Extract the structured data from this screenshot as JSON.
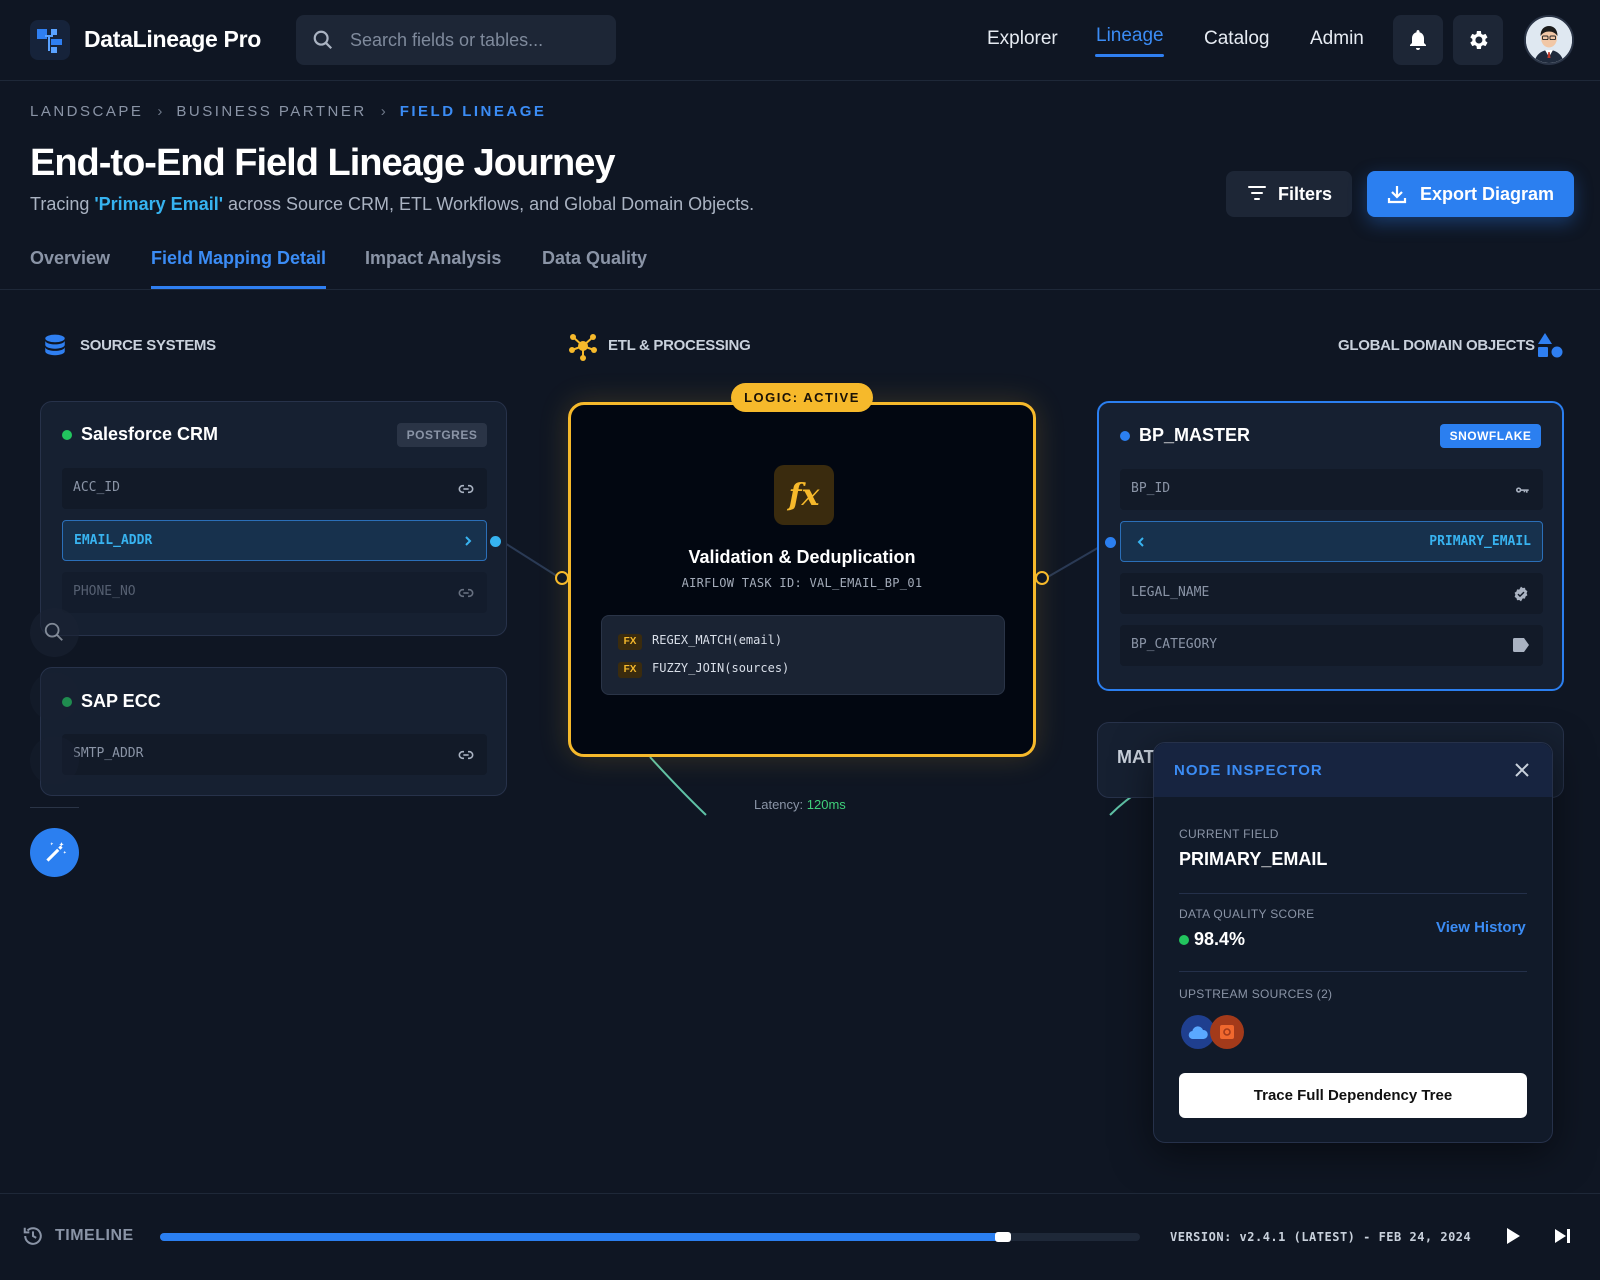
{
  "app": {
    "name": "DataLineage Pro"
  },
  "search": {
    "placeholder": "Search fields or tables..."
  },
  "nav": {
    "items": [
      {
        "label": "Explorer"
      },
      {
        "label": "Lineage"
      },
      {
        "label": "Catalog"
      },
      {
        "label": "Admin"
      }
    ],
    "active": "Lineage"
  },
  "breadcrumb": [
    "LANDSCAPE",
    "BUSINESS PARTNER",
    "FIELD LINEAGE"
  ],
  "page": {
    "title": "End-to-End Field Lineage Journey",
    "subtitle_pre": "Tracing ",
    "subtitle_hl": "'Primary Email'",
    "subtitle_post": " across Source CRM, ETL Workflows, and Global Domain Objects."
  },
  "actions": {
    "filters": "Filters",
    "export": "Export Diagram"
  },
  "tabs": [
    {
      "label": "Overview"
    },
    {
      "label": "Field Mapping Detail"
    },
    {
      "label": "Impact Analysis"
    },
    {
      "label": "Data Quality"
    }
  ],
  "columns": {
    "source": "SOURCE SYSTEMS",
    "etl": "ETL & PROCESSING",
    "domain": "GLOBAL DOMAIN OBJECTS"
  },
  "sources": [
    {
      "name": "Salesforce CRM",
      "badge": "POSTGRES",
      "fields": [
        "ACC_ID",
        "EMAIL_ADDR",
        "PHONE_NO"
      ]
    },
    {
      "name": "SAP ECC",
      "fields": [
        "SMTP_ADDR"
      ]
    }
  ],
  "etl": {
    "status": "LOGIC: ACTIVE",
    "title": "Validation & Deduplication",
    "task": "AIRFLOW TASK ID: VAL_EMAIL_BP_01",
    "tag": "FX",
    "functions": [
      "REGEX_MATCH(email)",
      "FUZZY_JOIN(sources)"
    ],
    "latency_label": "Latency: ",
    "latency_value": "120ms"
  },
  "domain": {
    "name": "BP_MASTER",
    "badge": "SNOWFLAKE",
    "fields": [
      "BP_ID",
      "PRIMARY_EMAIL",
      "LEGAL_NAME",
      "BP_CATEGORY"
    ],
    "second_card_title": "MAT"
  },
  "inspector": {
    "title": "NODE INSPECTOR",
    "current_field_label": "CURRENT FIELD",
    "current_field": "PRIMARY_EMAIL",
    "dq_label": "DATA QUALITY SCORE",
    "dq_value": "98.4%",
    "view_history": "View History",
    "upstream_label": "UPSTREAM SOURCES (2)",
    "trace_button": "Trace Full Dependency Tree"
  },
  "timeline": {
    "label": "TIMELINE",
    "progress": 0.86,
    "version": "VERSION: v2.4.1 (LATEST) - FEB 24, 2024"
  },
  "colors": {
    "accent": "#2b7ff0",
    "etl": "#f6b92b",
    "success": "#22c55e",
    "selected_text": "#38b3f0"
  },
  "icons": [
    "logo-icon",
    "search-icon",
    "bell-icon",
    "gear-icon",
    "database-icon",
    "hub-icon",
    "shapes-icon",
    "link-icon",
    "chevron-right-icon",
    "chevron-left-icon",
    "key-icon",
    "verified-icon",
    "tag-icon",
    "fx-icon",
    "close-icon",
    "cloud-icon",
    "box-icon",
    "magic-wand-icon",
    "history-icon",
    "play-icon",
    "skip-next-icon"
  ]
}
